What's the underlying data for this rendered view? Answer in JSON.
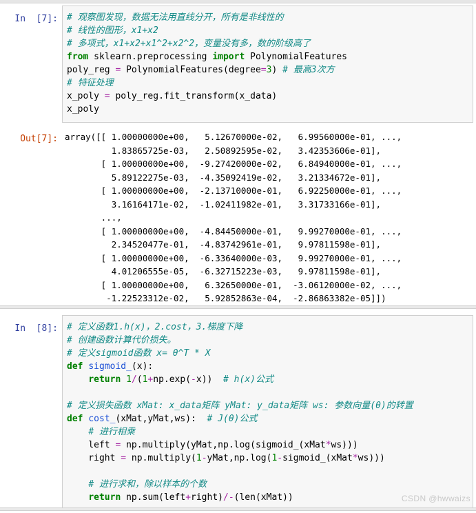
{
  "app": {
    "kind": "jupyter-notebook",
    "watermark": "CSDN @hwwaizs"
  },
  "theme": {
    "background": "#ffffff",
    "cell_input_bg": "#f7f7f7",
    "cell_border": "#cfcfcf",
    "in_prompt_color": "#303f9f",
    "out_prompt_color": "#c43e00",
    "comment_color": "#128a86",
    "keyword_color": "#008000",
    "function_color": "#1a4fd6",
    "operator_color": "#a626a4",
    "watermark_color": "#c9c9c9"
  },
  "cells": [
    {
      "id": "cell-1",
      "type": "code",
      "prompt": "In  [7]:",
      "source_lines": [
        "# 观察图发现，数据无法用直线分开，所有是非线性的",
        "# 线性的图形，x1+x2",
        "# 多项式，x1+x2+x1^2+x2^2，变量没有多，数的阶级高了",
        "from sklearn.preprocessing import PolynomialFeatures",
        "poly_reg = PolynomialFeatures(degree=3) # 最高3次方",
        "# 特征处理",
        "x_poly = poly_reg.fit_transform(x_data)",
        "x_poly"
      ],
      "output": {
        "prompt": "Out[7]:",
        "type": "execute_result",
        "text_lines": [
          "array([[ 1.00000000e+00,   5.12670000e-02,   6.99560000e-01, ...,",
          "         1.83865725e-03,   2.50892595e-02,   3.42353606e-01],",
          "       [ 1.00000000e+00,  -9.27420000e-02,   6.84940000e-01, ...,",
          "         5.89122275e-03,  -4.35092419e-02,   3.21334672e-01],",
          "       [ 1.00000000e+00,  -2.13710000e-01,   6.92250000e-01, ...,",
          "         3.16164171e-02,  -1.02411982e-01,   3.31733166e-01],",
          "       ...,",
          "       [ 1.00000000e+00,  -4.84450000e-01,   9.99270000e-01, ...,",
          "         2.34520477e-01,  -4.83742961e-01,   9.97811598e-01],",
          "       [ 1.00000000e+00,  -6.33640000e-03,   9.99270000e-01, ...,",
          "         4.01206555e-05,  -6.32715223e-03,   9.97811598e-01],",
          "       [ 1.00000000e+00,   6.32650000e-01,  -3.06120000e-02, ...,",
          "        -1.22523312e-02,   5.92852863e-04,  -2.86863382e-05]])"
        ]
      }
    },
    {
      "id": "cell-2",
      "type": "code",
      "prompt": "In  [8]:",
      "source_lines": [
        "# 定义函数1.h(x)，2.cost，3.梯度下降",
        "# 创建函数计算代价损失。",
        "# 定义sigmoid函数 x= θ^T * X",
        "def sigmoid_(x):",
        "    return 1/(1+np.exp(-x))  # h(x)公式",
        "",
        "# 定义损失函数 xMat: x_data矩阵 yMat: y_data矩阵 ws: 参数向量(θ)的转置",
        "def cost_(xMat,yMat,ws):  # J(θ)公式",
        "    # 进行相乘",
        "    left = np.multiply(yMat,np.log(sigmoid_(xMat*ws)))",
        "    right = np.multiply(1-yMat,np.log(1-sigmoid_(xMat*ws)))",
        "",
        "    # 进行求和，除以样本的个数",
        "    return np.sum(left+right)/-(len(xMat))"
      ],
      "output": null
    }
  ]
}
